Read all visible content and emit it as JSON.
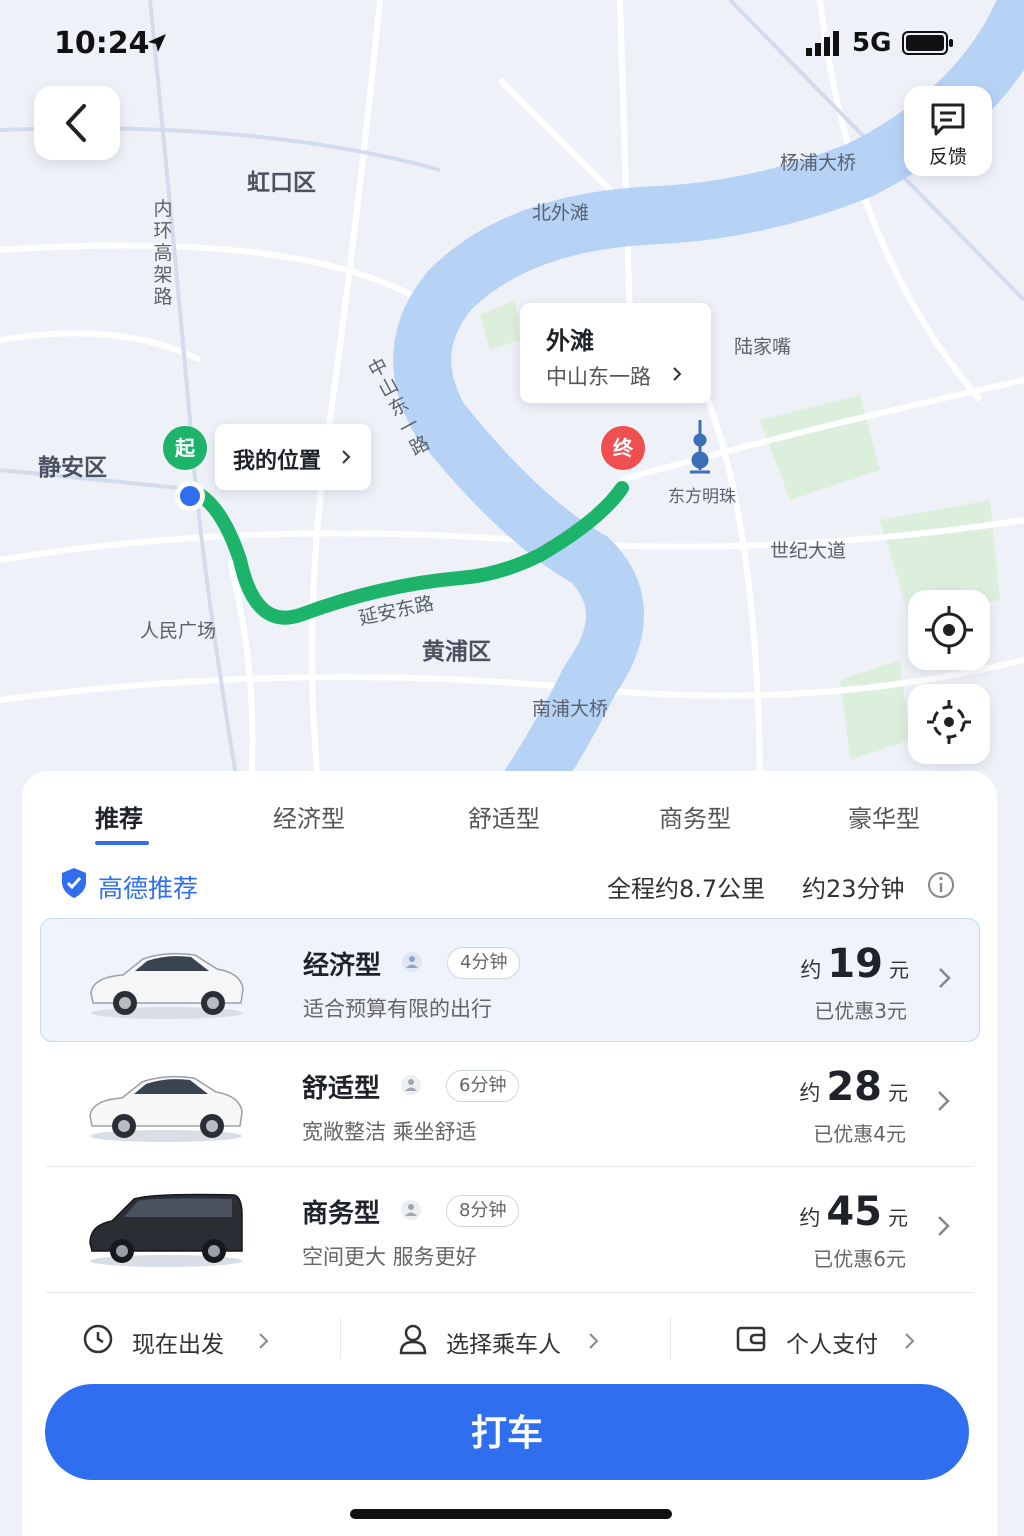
{
  "status": {
    "time": "10:24",
    "network": "5G"
  },
  "map": {
    "districts": {
      "hongkou": "虹口区",
      "jingan": "静安区",
      "huangpu": "黄浦区"
    },
    "labels": {
      "bund_north": "北外滩",
      "yangpu_bridge": "杨浦大桥",
      "lujiazui": "陆家嘴",
      "pearl_tower": "东方明珠",
      "century_ave": "世纪大道",
      "people_square": "人民广场",
      "yanan_road": "延安东路",
      "nanpu_bridge": "南浦大桥",
      "inner_ring": "内环高架路",
      "zhongshan_road": "中山东一路"
    },
    "start_pin": "起",
    "end_pin": "终",
    "my_location": "我的位置",
    "destination": {
      "title": "外滩",
      "subtitle": "中山东一路"
    }
  },
  "header": {
    "feedback_label": "反馈"
  },
  "tabs": [
    "推荐",
    "经济型",
    "舒适型",
    "商务型",
    "豪华型"
  ],
  "recommend": {
    "label": "高德推荐",
    "distance": "全程约8.7公里",
    "duration": "约23分钟"
  },
  "rides": [
    {
      "name": "经济型",
      "eta": "4分钟",
      "desc": "适合预算有限的出行",
      "prefix": "约",
      "price": "19",
      "unit": "元",
      "discount": "已优惠3元"
    },
    {
      "name": "舒适型",
      "eta": "6分钟",
      "desc": "宽敞整洁 乘坐舒适",
      "prefix": "约",
      "price": "28",
      "unit": "元",
      "discount": "已优惠4元"
    },
    {
      "name": "商务型",
      "eta": "8分钟",
      "desc": "空间更大 服务更好",
      "prefix": "约",
      "price": "45",
      "unit": "元",
      "discount": "已优惠6元"
    }
  ],
  "options": {
    "depart": "现在出发",
    "passenger": "选择乘车人",
    "payment": "个人支付"
  },
  "cta": "打车",
  "colors": {
    "accent": "#2f6fef",
    "route": "#1db36a",
    "river": "#b6d2f5",
    "start_pin": "#1db36a",
    "end_pin": "#ef4f4f"
  }
}
